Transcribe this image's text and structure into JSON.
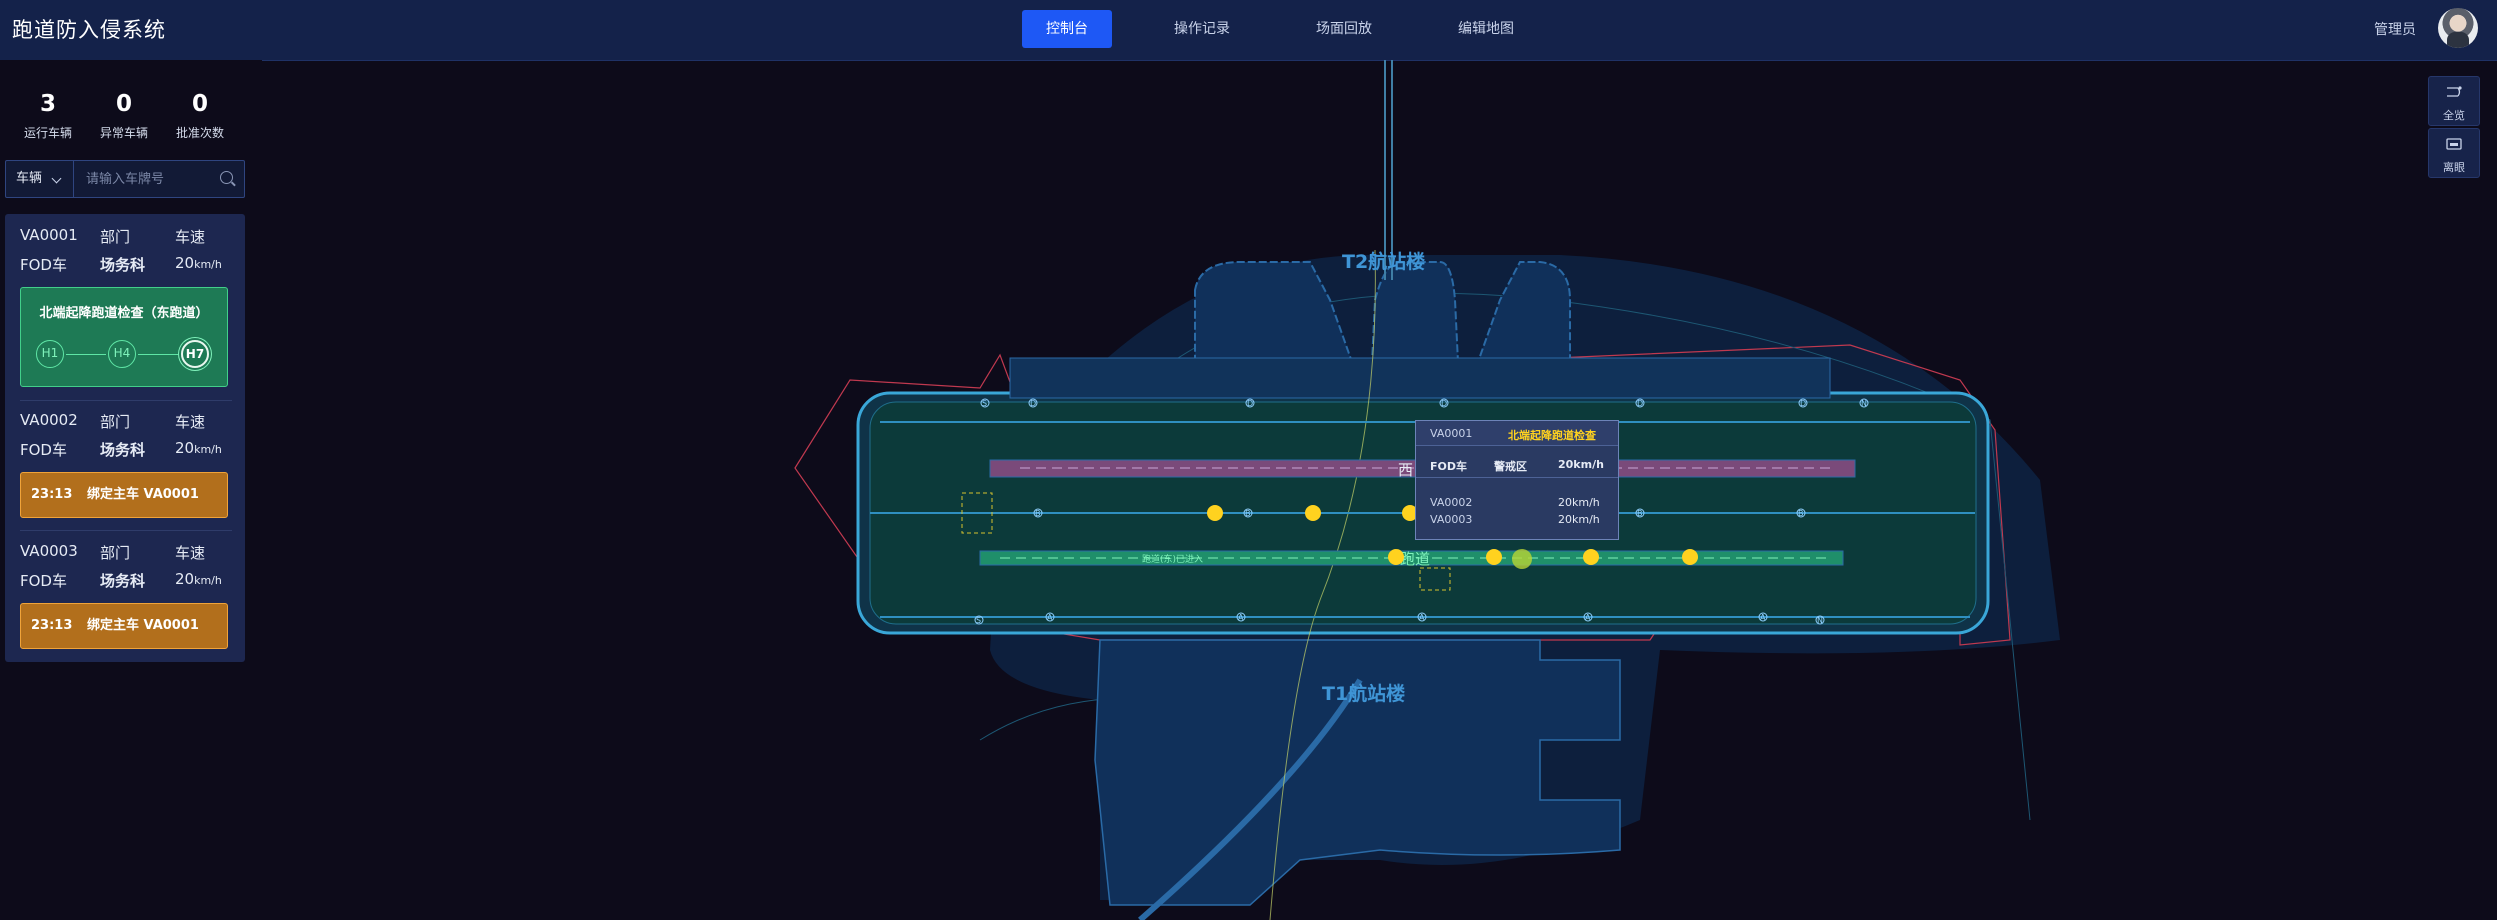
{
  "app_title": "跑道防入侵系统",
  "nav": [
    "控制台",
    "操作记录",
    "场面回放",
    "编辑地图"
  ],
  "user": {
    "name": "管理员"
  },
  "stats": [
    {
      "value": "3",
      "label": "运行车辆"
    },
    {
      "value": "0",
      "label": "异常车辆"
    },
    {
      "value": "0",
      "label": "批准次数"
    }
  ],
  "search": {
    "type": "车辆",
    "placeholder": "请输入车牌号"
  },
  "vehicles": [
    {
      "id": "VA0001",
      "dept_label": "部门",
      "speed_label": "车速",
      "type": "FOD车",
      "dept": "场务科",
      "speed": "20",
      "unit": "km/h",
      "route": {
        "title": "北端起降跑道检查（东跑道）",
        "nodes": [
          "H1",
          "H4",
          "H7"
        ]
      }
    },
    {
      "id": "VA0002",
      "dept_label": "部门",
      "speed_label": "车速",
      "type": "FOD车",
      "dept": "场务科",
      "speed": "20",
      "unit": "km/h",
      "bind": {
        "time": "23:13",
        "text": "绑定主车 VA0001"
      }
    },
    {
      "id": "VA0003",
      "dept_label": "部门",
      "speed_label": "车速",
      "type": "FOD车",
      "dept": "场务科",
      "speed": "20",
      "unit": "km/h",
      "bind": {
        "time": "23:13",
        "text": "绑定主车 VA0001"
      }
    }
  ],
  "map": {
    "labels": {
      "t2": "T2航站楼",
      "t1": "T1航站楼",
      "west": "西",
      "runway": "跑道",
      "runway_note": "跑道(东)已进入"
    },
    "tools": [
      {
        "label": "全览",
        "icon": "route-icon"
      },
      {
        "label": "离眼",
        "icon": "screen-icon"
      }
    ],
    "taxi_labels_top": [
      "S",
      "D",
      "D",
      "D",
      "D",
      "D",
      "N"
    ],
    "taxi_labels_mid": [
      "B",
      "B",
      "B",
      "B",
      "B"
    ],
    "taxi_labels_bottom": [
      "S",
      "A",
      "A",
      "A",
      "A",
      "A",
      "N"
    ]
  },
  "popup": {
    "id": "VA0001",
    "task": "北端起降跑道检查",
    "type": "FOD车",
    "zone": "警戒区",
    "speed": "20km/h",
    "sub": [
      {
        "id": "VA0002",
        "speed": "20km/h"
      },
      {
        "id": "VA0003",
        "speed": "20km/h"
      }
    ]
  },
  "colors": {
    "accent": "#1e58f5",
    "route_green": "#1e7a55",
    "bind_orange": "#b26f1c",
    "runway_pink": "#7a4a7a",
    "runway_green": "#1f8f6a",
    "vehicle_yellow": "#ffd21f"
  }
}
